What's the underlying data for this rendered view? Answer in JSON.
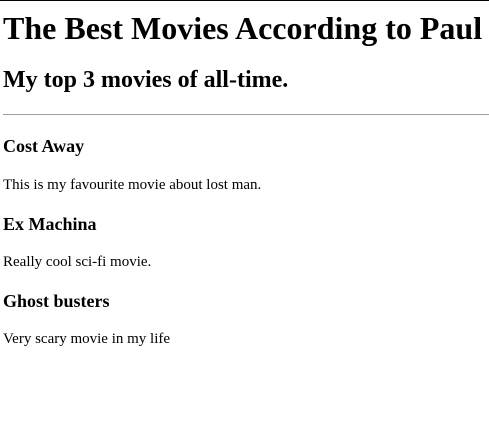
{
  "page": {
    "title": "The Best Movies According to Paul",
    "subtitle": "My top 3 movies of all-time."
  },
  "movies": [
    {
      "title": "Cost Away",
      "description": "This is my favourite movie about lost man."
    },
    {
      "title": "Ex Machina",
      "description": "Really cool sci-fi movie."
    },
    {
      "title": "Ghost busters",
      "description": "Very scary movie in my life"
    }
  ]
}
